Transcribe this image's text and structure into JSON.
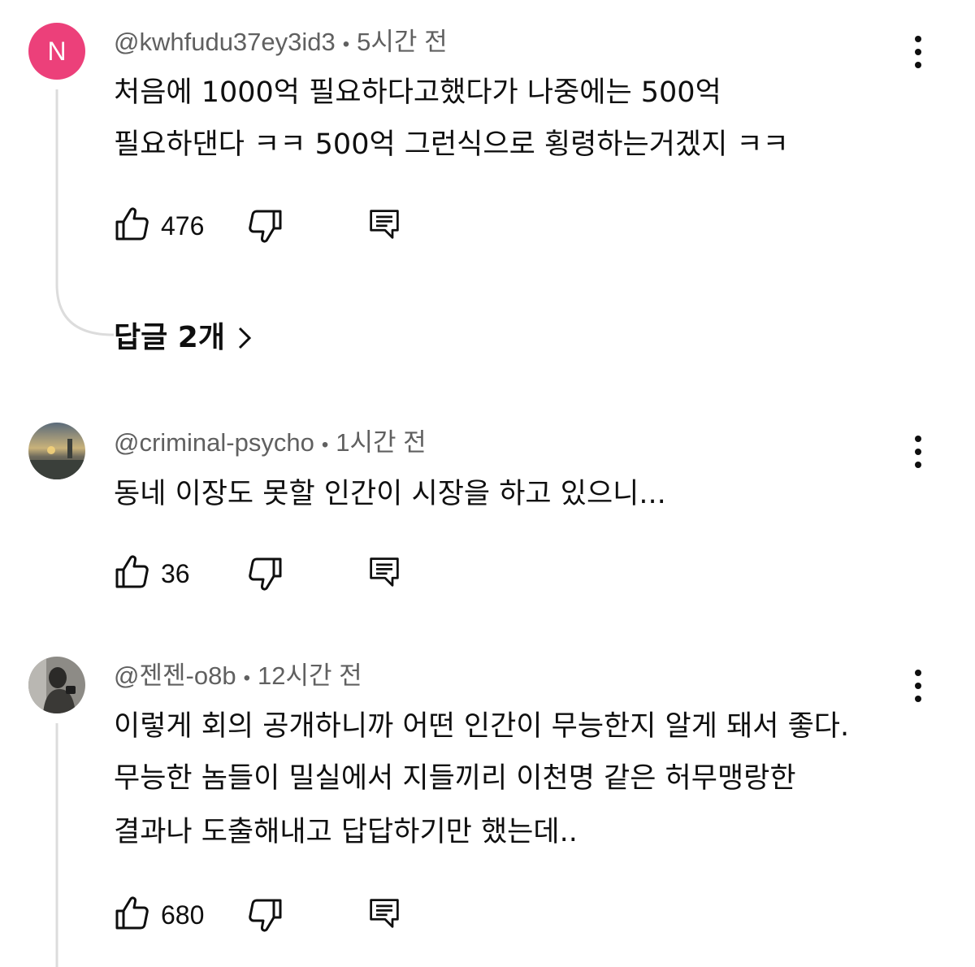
{
  "comments": [
    {
      "avatar_letter": "N",
      "avatar_color": "#ec407a",
      "author": "@kwhfudu37ey3id3",
      "separator": "•",
      "time": "5시간 전",
      "lines": [
        "처음에 1000억 필요하다고했다가 나중에는 500억",
        "필요하댄다 ㅋㅋ 500억 그런식으로 횡령하는거겠지 ㅋㅋ"
      ],
      "likes": "476",
      "replies_label": "답글 2개"
    },
    {
      "author": "@criminal-psycho",
      "separator": "•",
      "time": "1시간 전",
      "lines": [
        "동네 이장도 못할 인간이 시장을 하고 있으니..."
      ],
      "likes": "36"
    },
    {
      "author": "@젠젠-o8b",
      "separator": "•",
      "time": "12시간 전",
      "lines": [
        "이렇게 회의 공개하니까 어떤 인간이 무능한지 알게 돼서 좋다.",
        "무능한 놈들이 밀실에서 지들끼리 이천명 같은 허무맹랑한",
        "결과나 도출해내고 답답하기만 했는데.."
      ],
      "likes": "680"
    }
  ],
  "icons": {
    "like": "thumb-up-icon",
    "dislike": "thumb-down-icon",
    "reply": "comment-reply-icon",
    "menu": "more-vert-icon",
    "chevron": "chevron-right-icon"
  }
}
